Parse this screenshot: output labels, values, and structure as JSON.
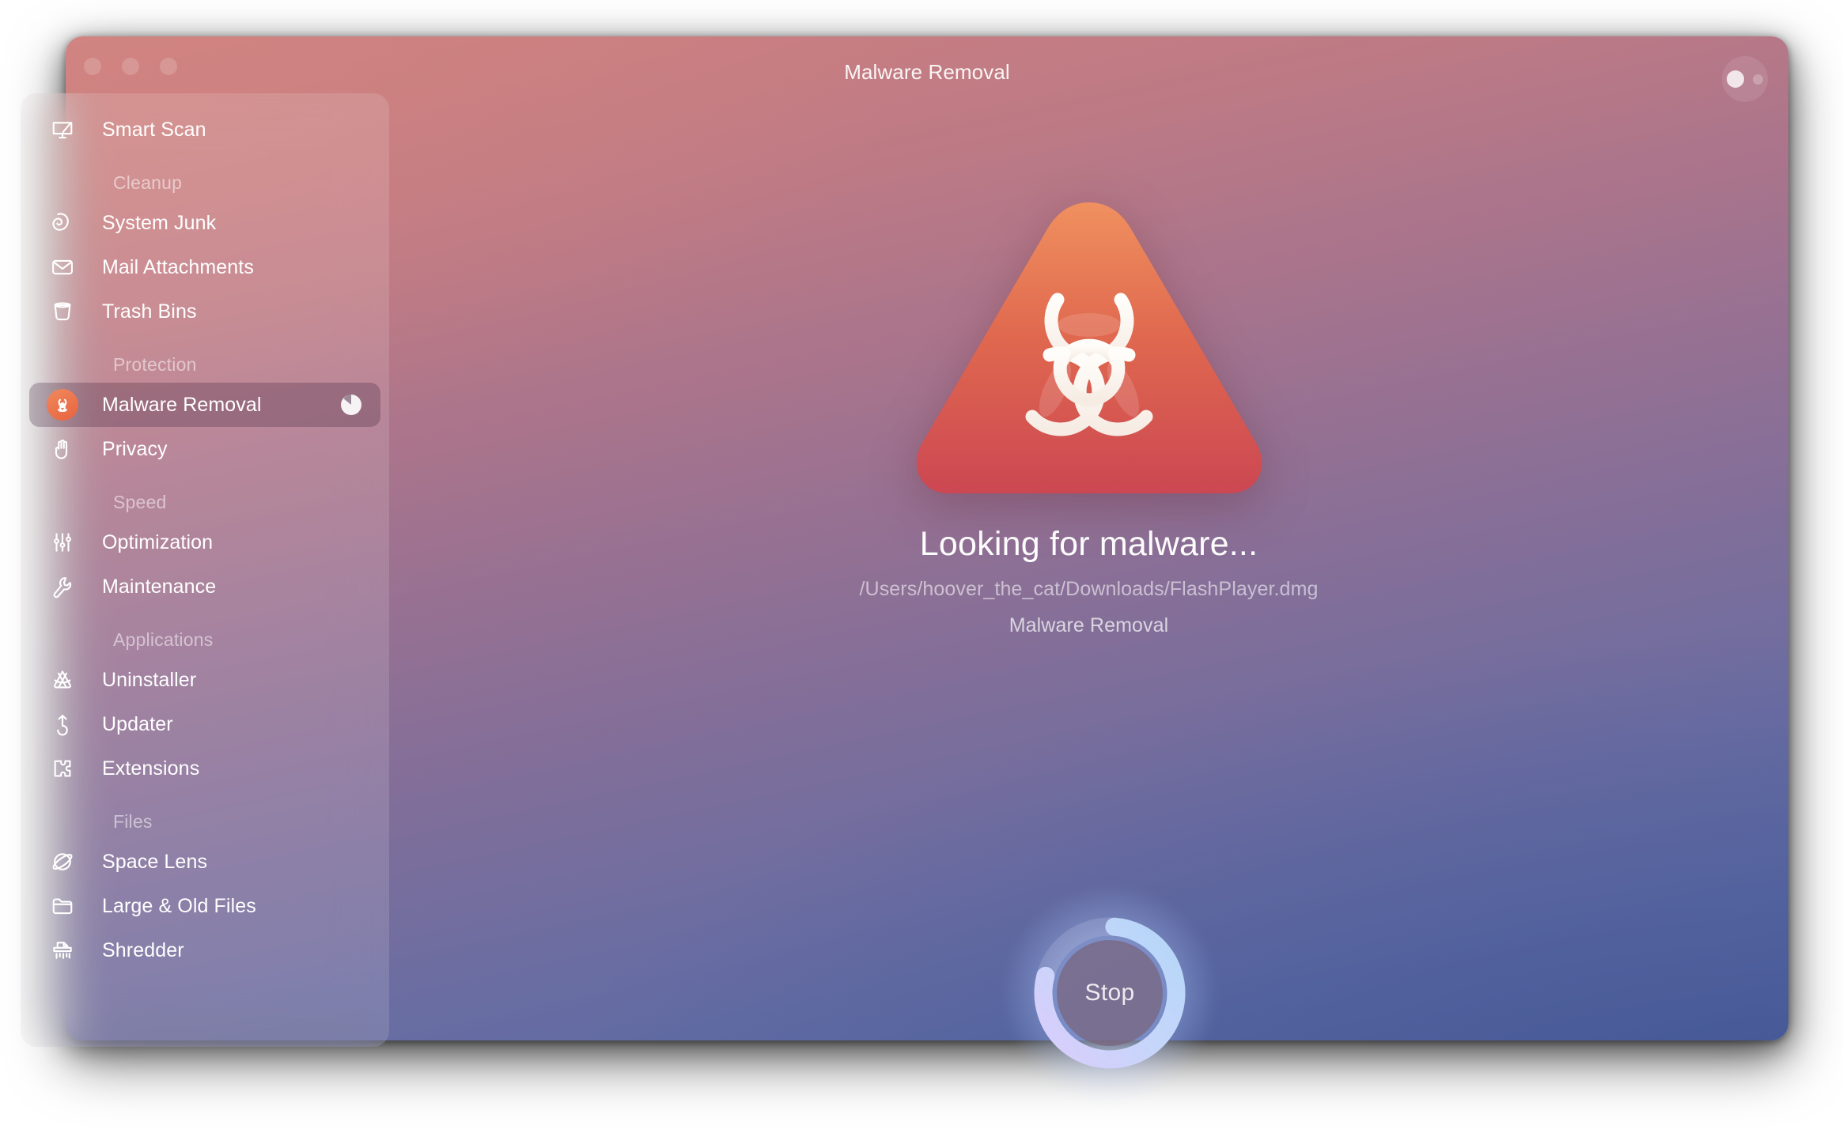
{
  "window": {
    "title": "Malware Removal",
    "traffic_lights": [
      "close",
      "minimize",
      "zoom"
    ],
    "more_button": "more-options"
  },
  "sidebar": {
    "groups": [
      {
        "header": "",
        "items": [
          {
            "label": "Smart Scan",
            "icon": "display-icon",
            "selected": false
          }
        ]
      },
      {
        "header": "Cleanup",
        "items": [
          {
            "label": "System Junk",
            "icon": "crumpled-paper-icon",
            "selected": false
          },
          {
            "label": "Mail Attachments",
            "icon": "envelope-icon",
            "selected": false
          },
          {
            "label": "Trash Bins",
            "icon": "trash-bin-icon",
            "selected": false
          }
        ]
      },
      {
        "header": "Protection",
        "items": [
          {
            "label": "Malware Removal",
            "icon": "biohazard-icon",
            "selected": true,
            "trailing": "scan-progress-pie"
          },
          {
            "label": "Privacy",
            "icon": "hand-icon",
            "selected": false
          }
        ]
      },
      {
        "header": "Speed",
        "items": [
          {
            "label": "Optimization",
            "icon": "sliders-icon",
            "selected": false
          },
          {
            "label": "Maintenance",
            "icon": "wrench-icon",
            "selected": false
          }
        ]
      },
      {
        "header": "Applications",
        "items": [
          {
            "label": "Uninstaller",
            "icon": "app-bundle-icon",
            "selected": false
          },
          {
            "label": "Updater",
            "icon": "update-arrow-icon",
            "selected": false
          },
          {
            "label": "Extensions",
            "icon": "puzzle-piece-icon",
            "selected": false
          }
        ]
      },
      {
        "header": "Files",
        "items": [
          {
            "label": "Space Lens",
            "icon": "planet-icon",
            "selected": false
          },
          {
            "label": "Large & Old Files",
            "icon": "folder-icon",
            "selected": false
          },
          {
            "label": "Shredder",
            "icon": "shredder-icon",
            "selected": false
          }
        ]
      }
    ]
  },
  "main": {
    "hero_icon": "biohazard-warning-triangle",
    "status_title": "Looking for malware...",
    "status_path": "/Users/hoover_the_cat/Downloads/FlashPlayer.dmg",
    "status_module": "Malware Removal",
    "stop_button": "Stop",
    "progress_percent": 78
  },
  "colors": {
    "accent_warning": "#e8623f",
    "hero_top": "#ef8a5f",
    "hero_bottom": "#cf4a4f",
    "progress_ring": "#bcd0fb",
    "window_top": "#cd8180",
    "window_bottom": "#4e66a0"
  }
}
